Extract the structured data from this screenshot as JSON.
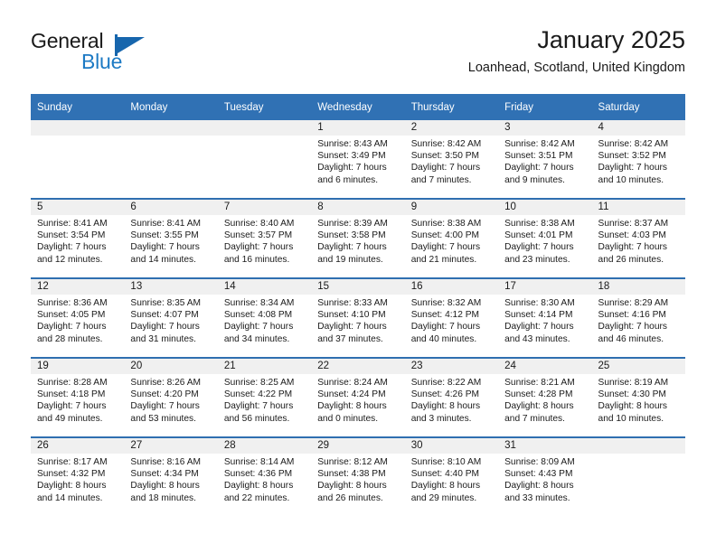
{
  "logo": {
    "word1": "General",
    "word2": "Blue",
    "triangle_color": "#1766ad",
    "blue_color": "#1d7ac4"
  },
  "header": {
    "title": "January 2025",
    "subtitle": "Loanhead, Scotland, United Kingdom"
  },
  "theme": {
    "header_blue": "#3071b4",
    "row_divider_blue": "#2f6fb0",
    "day_band_gray": "#f0f0f0"
  },
  "weekdays": [
    "Sunday",
    "Monday",
    "Tuesday",
    "Wednesday",
    "Thursday",
    "Friday",
    "Saturday"
  ],
  "weeks": [
    [
      {
        "day": "",
        "empty": true
      },
      {
        "day": "",
        "empty": true
      },
      {
        "day": "",
        "empty": true
      },
      {
        "day": "1",
        "sunrise": "Sunrise: 8:43 AM",
        "sunset": "Sunset: 3:49 PM",
        "daylight1": "Daylight: 7 hours",
        "daylight2": "and 6 minutes."
      },
      {
        "day": "2",
        "sunrise": "Sunrise: 8:42 AM",
        "sunset": "Sunset: 3:50 PM",
        "daylight1": "Daylight: 7 hours",
        "daylight2": "and 7 minutes."
      },
      {
        "day": "3",
        "sunrise": "Sunrise: 8:42 AM",
        "sunset": "Sunset: 3:51 PM",
        "daylight1": "Daylight: 7 hours",
        "daylight2": "and 9 minutes."
      },
      {
        "day": "4",
        "sunrise": "Sunrise: 8:42 AM",
        "sunset": "Sunset: 3:52 PM",
        "daylight1": "Daylight: 7 hours",
        "daylight2": "and 10 minutes."
      }
    ],
    [
      {
        "day": "5",
        "sunrise": "Sunrise: 8:41 AM",
        "sunset": "Sunset: 3:54 PM",
        "daylight1": "Daylight: 7 hours",
        "daylight2": "and 12 minutes."
      },
      {
        "day": "6",
        "sunrise": "Sunrise: 8:41 AM",
        "sunset": "Sunset: 3:55 PM",
        "daylight1": "Daylight: 7 hours",
        "daylight2": "and 14 minutes."
      },
      {
        "day": "7",
        "sunrise": "Sunrise: 8:40 AM",
        "sunset": "Sunset: 3:57 PM",
        "daylight1": "Daylight: 7 hours",
        "daylight2": "and 16 minutes."
      },
      {
        "day": "8",
        "sunrise": "Sunrise: 8:39 AM",
        "sunset": "Sunset: 3:58 PM",
        "daylight1": "Daylight: 7 hours",
        "daylight2": "and 19 minutes."
      },
      {
        "day": "9",
        "sunrise": "Sunrise: 8:38 AM",
        "sunset": "Sunset: 4:00 PM",
        "daylight1": "Daylight: 7 hours",
        "daylight2": "and 21 minutes."
      },
      {
        "day": "10",
        "sunrise": "Sunrise: 8:38 AM",
        "sunset": "Sunset: 4:01 PM",
        "daylight1": "Daylight: 7 hours",
        "daylight2": "and 23 minutes."
      },
      {
        "day": "11",
        "sunrise": "Sunrise: 8:37 AM",
        "sunset": "Sunset: 4:03 PM",
        "daylight1": "Daylight: 7 hours",
        "daylight2": "and 26 minutes."
      }
    ],
    [
      {
        "day": "12",
        "sunrise": "Sunrise: 8:36 AM",
        "sunset": "Sunset: 4:05 PM",
        "daylight1": "Daylight: 7 hours",
        "daylight2": "and 28 minutes."
      },
      {
        "day": "13",
        "sunrise": "Sunrise: 8:35 AM",
        "sunset": "Sunset: 4:07 PM",
        "daylight1": "Daylight: 7 hours",
        "daylight2": "and 31 minutes."
      },
      {
        "day": "14",
        "sunrise": "Sunrise: 8:34 AM",
        "sunset": "Sunset: 4:08 PM",
        "daylight1": "Daylight: 7 hours",
        "daylight2": "and 34 minutes."
      },
      {
        "day": "15",
        "sunrise": "Sunrise: 8:33 AM",
        "sunset": "Sunset: 4:10 PM",
        "daylight1": "Daylight: 7 hours",
        "daylight2": "and 37 minutes."
      },
      {
        "day": "16",
        "sunrise": "Sunrise: 8:32 AM",
        "sunset": "Sunset: 4:12 PM",
        "daylight1": "Daylight: 7 hours",
        "daylight2": "and 40 minutes."
      },
      {
        "day": "17",
        "sunrise": "Sunrise: 8:30 AM",
        "sunset": "Sunset: 4:14 PM",
        "daylight1": "Daylight: 7 hours",
        "daylight2": "and 43 minutes."
      },
      {
        "day": "18",
        "sunrise": "Sunrise: 8:29 AM",
        "sunset": "Sunset: 4:16 PM",
        "daylight1": "Daylight: 7 hours",
        "daylight2": "and 46 minutes."
      }
    ],
    [
      {
        "day": "19",
        "sunrise": "Sunrise: 8:28 AM",
        "sunset": "Sunset: 4:18 PM",
        "daylight1": "Daylight: 7 hours",
        "daylight2": "and 49 minutes."
      },
      {
        "day": "20",
        "sunrise": "Sunrise: 8:26 AM",
        "sunset": "Sunset: 4:20 PM",
        "daylight1": "Daylight: 7 hours",
        "daylight2": "and 53 minutes."
      },
      {
        "day": "21",
        "sunrise": "Sunrise: 8:25 AM",
        "sunset": "Sunset: 4:22 PM",
        "daylight1": "Daylight: 7 hours",
        "daylight2": "and 56 minutes."
      },
      {
        "day": "22",
        "sunrise": "Sunrise: 8:24 AM",
        "sunset": "Sunset: 4:24 PM",
        "daylight1": "Daylight: 8 hours",
        "daylight2": "and 0 minutes."
      },
      {
        "day": "23",
        "sunrise": "Sunrise: 8:22 AM",
        "sunset": "Sunset: 4:26 PM",
        "daylight1": "Daylight: 8 hours",
        "daylight2": "and 3 minutes."
      },
      {
        "day": "24",
        "sunrise": "Sunrise: 8:21 AM",
        "sunset": "Sunset: 4:28 PM",
        "daylight1": "Daylight: 8 hours",
        "daylight2": "and 7 minutes."
      },
      {
        "day": "25",
        "sunrise": "Sunrise: 8:19 AM",
        "sunset": "Sunset: 4:30 PM",
        "daylight1": "Daylight: 8 hours",
        "daylight2": "and 10 minutes."
      }
    ],
    [
      {
        "day": "26",
        "sunrise": "Sunrise: 8:17 AM",
        "sunset": "Sunset: 4:32 PM",
        "daylight1": "Daylight: 8 hours",
        "daylight2": "and 14 minutes."
      },
      {
        "day": "27",
        "sunrise": "Sunrise: 8:16 AM",
        "sunset": "Sunset: 4:34 PM",
        "daylight1": "Daylight: 8 hours",
        "daylight2": "and 18 minutes."
      },
      {
        "day": "28",
        "sunrise": "Sunrise: 8:14 AM",
        "sunset": "Sunset: 4:36 PM",
        "daylight1": "Daylight: 8 hours",
        "daylight2": "and 22 minutes."
      },
      {
        "day": "29",
        "sunrise": "Sunrise: 8:12 AM",
        "sunset": "Sunset: 4:38 PM",
        "daylight1": "Daylight: 8 hours",
        "daylight2": "and 26 minutes."
      },
      {
        "day": "30",
        "sunrise": "Sunrise: 8:10 AM",
        "sunset": "Sunset: 4:40 PM",
        "daylight1": "Daylight: 8 hours",
        "daylight2": "and 29 minutes."
      },
      {
        "day": "31",
        "sunrise": "Sunrise: 8:09 AM",
        "sunset": "Sunset: 4:43 PM",
        "daylight1": "Daylight: 8 hours",
        "daylight2": "and 33 minutes."
      },
      {
        "day": "",
        "empty": true
      }
    ]
  ]
}
